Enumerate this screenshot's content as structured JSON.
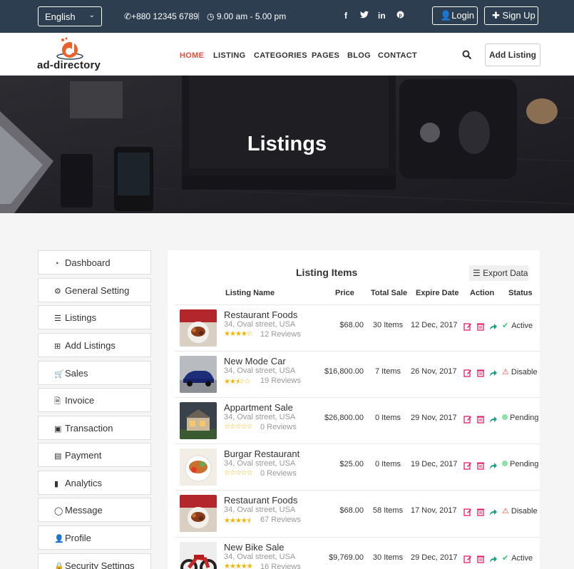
{
  "topbar": {
    "language": "English",
    "phone": "+880 12345 6789",
    "separator": "|",
    "hours": "9.00 am - 5.00 pm",
    "social": [
      "f",
      "t",
      "in",
      "p"
    ],
    "login_label": "Login",
    "signup_label": "Sign Up"
  },
  "navbar": {
    "logo_text": "ad-directory",
    "items": [
      "HOME",
      "LISTING",
      "CATEGORIES",
      "PAGES",
      "BLOG",
      "CONTACT"
    ],
    "add_listing_label": "Add Listing"
  },
  "hero": {
    "title": "Listings"
  },
  "sidebar": {
    "items": [
      {
        "label": "Dashboard",
        "icon": "dashboard-icon"
      },
      {
        "label": "General Setting",
        "icon": "gear-icon"
      },
      {
        "label": "Listings",
        "icon": "list-icon"
      },
      {
        "label": "Add Listings",
        "icon": "plus-square-icon"
      },
      {
        "label": "Sales",
        "icon": "cart-icon"
      },
      {
        "label": "Invoice",
        "icon": "file-icon"
      },
      {
        "label": "Transaction",
        "icon": "money-icon"
      },
      {
        "label": "Payment",
        "icon": "credit-card-icon"
      },
      {
        "label": "Analytics",
        "icon": "bar-chart-icon"
      },
      {
        "label": "Message",
        "icon": "comment-icon"
      },
      {
        "label": "Profile",
        "icon": "user-icon"
      },
      {
        "label": "Security Settings",
        "icon": "lock-icon"
      }
    ]
  },
  "panel": {
    "title": "Listing Items",
    "export_label": "Export Data",
    "columns": [
      "Listing Name",
      "Price",
      "Total Sale",
      "Expire Date",
      "Action",
      "Status"
    ],
    "rows": [
      {
        "name": "Restaurant Foods",
        "address": "34, Oval street, USA",
        "rating": 4,
        "reviews": "12 Reviews",
        "price": "$68.00",
        "sales": "30 Items",
        "expire": "12 Dec, 2017",
        "status": "Active",
        "status_type": "active"
      },
      {
        "name": "New Mode Car",
        "address": "34, Oval street, USA",
        "rating": 2.5,
        "reviews": "19 Reviews",
        "price": "$16,800.00",
        "sales": "7 Items",
        "expire": "26 Nov, 2017",
        "status": "Disable",
        "status_type": "disable"
      },
      {
        "name": "Appartment Sale",
        "address": "34, Oval street, USA",
        "rating": 0,
        "reviews": "0 Reviews",
        "price": "$26,800.00",
        "sales": "0 Items",
        "expire": "29 Nov, 2017",
        "status": "Pending",
        "status_type": "pending"
      },
      {
        "name": "Burgar Restaurant",
        "address": "34, Oval street, USA",
        "rating": 0,
        "reviews": "0 Reviews",
        "price": "$25.00",
        "sales": "0 Items",
        "expire": "19 Dec, 2017",
        "status": "Pending",
        "status_type": "pending"
      },
      {
        "name": "Restaurant Foods",
        "address": "34, Oval street, USA",
        "rating": 4.5,
        "reviews": "67 Reviews",
        "price": "$68.00",
        "sales": "58 Items",
        "expire": "17 Nov, 2017",
        "status": "Disable",
        "status_type": "disable"
      },
      {
        "name": "New Bike Sale",
        "address": "34, Oval street, USA",
        "rating": 5,
        "reviews": "16 Reviews",
        "price": "$9,769.00",
        "sales": "30 Items",
        "expire": "29 Dec, 2017",
        "status": "Active",
        "status_type": "active"
      }
    ]
  },
  "colors": {
    "accent": "#e74c3c",
    "topbar": "#2c3e50",
    "star": "#f4b400",
    "active": "#2ecc71",
    "disable": "#e74c3c",
    "pending": "#8ee0a8",
    "edit": "#e91e63",
    "share": "#16a085"
  }
}
